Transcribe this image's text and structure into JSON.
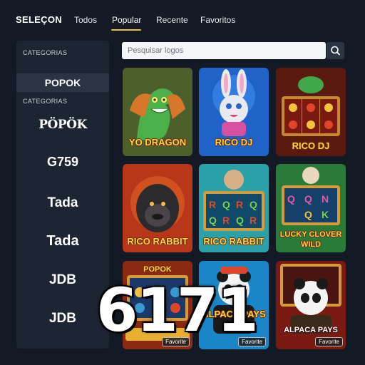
{
  "header": {
    "brand": "SELEÇON",
    "tabs": [
      {
        "label": "Todos"
      },
      {
        "label": "Popular"
      },
      {
        "label": "Recente"
      },
      {
        "label": "Favoritos"
      }
    ],
    "active_tab": "Popular",
    "accent_color": "#e9c233"
  },
  "sidebar": {
    "heading_top": "CATEGORIAS",
    "selected": "POPOK",
    "heading_second": "CATEGORIAS",
    "providers": [
      "PÖPÖK",
      "G759",
      "Tada",
      "Tada",
      "JDB",
      "JDB"
    ]
  },
  "search": {
    "placeholder": "Pesquisar logos",
    "icon": "search-icon"
  },
  "games": [
    {
      "title": "YO DRAGON",
      "favorite": false
    },
    {
      "title": "RICO DJ",
      "favorite": false
    },
    {
      "title": "RICO DJ",
      "favorite": false
    },
    {
      "title": "RICO RABBIT",
      "favorite": false
    },
    {
      "title": "RICO RABBIT",
      "favorite": false
    },
    {
      "title": "LUCKY CLOVER WILD",
      "favorite": false
    },
    {
      "title": "POPOK",
      "favorite": true
    },
    {
      "title": "ALPACA PAYS",
      "favorite": true
    },
    {
      "title": "ALPACA PAYS",
      "favorite": true
    }
  ],
  "favorite_label": "Favorite",
  "overlay_number": "6171"
}
